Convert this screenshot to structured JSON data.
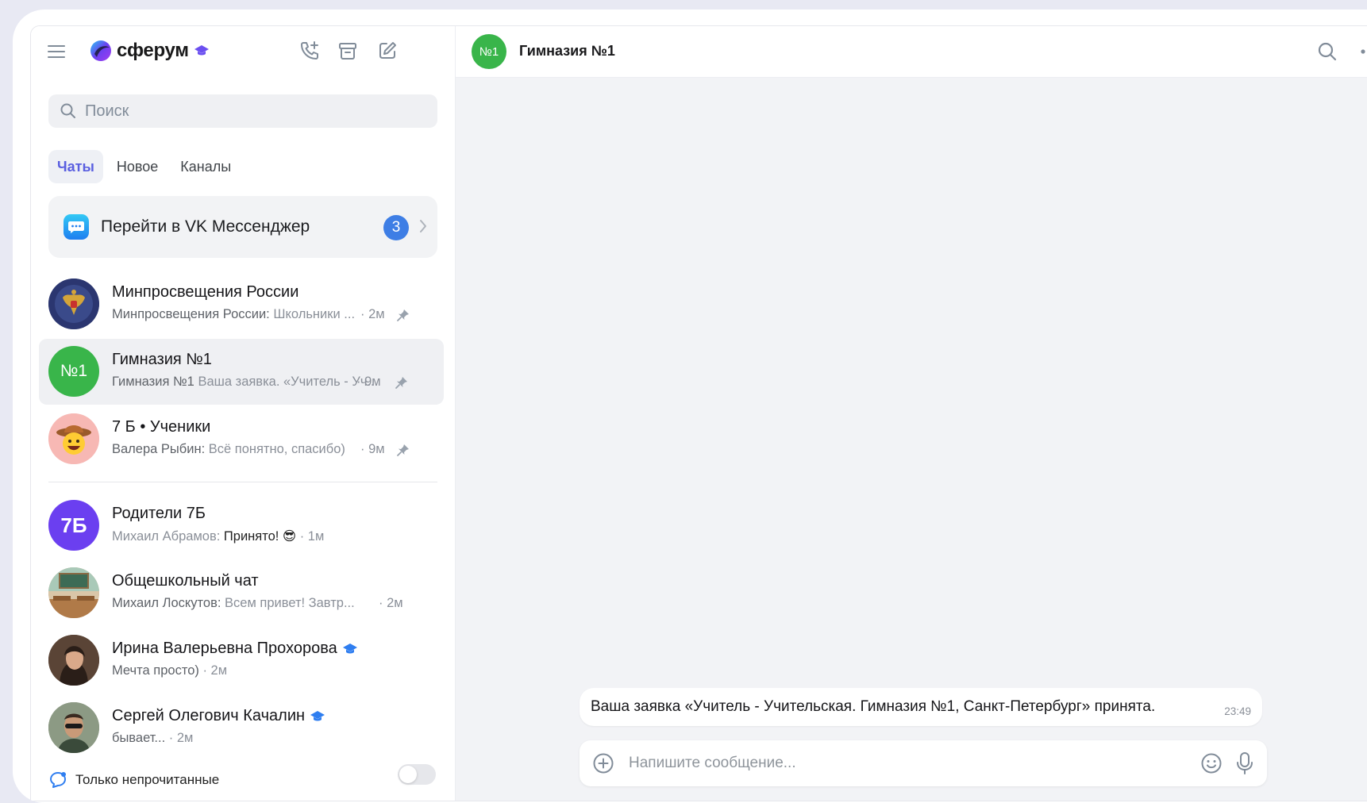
{
  "app": {
    "logo_text": "сферум"
  },
  "search": {
    "placeholder": "Поиск"
  },
  "tabs": [
    {
      "label": "Чаты",
      "active": true
    },
    {
      "label": "Новое",
      "active": false
    },
    {
      "label": "Каналы",
      "active": false
    }
  ],
  "vk_card": {
    "label": "Перейти в VK Мессенджер",
    "badge": "3"
  },
  "chats": [
    {
      "title": "Минпросвещения России",
      "who": "Минпросвещения России:",
      "preview": "Школьники ...",
      "time": "· 2м",
      "pinned": true
    },
    {
      "title": "Гимназия №1",
      "avatar_text": "№1",
      "who": "Гимназия №1",
      "preview": "Ваша заявка. «Учитель - Уч...",
      "time": "· 9м",
      "pinned": true,
      "selected": true
    },
    {
      "title": "7 Б • Ученики",
      "who": "Валера Рыбин:",
      "preview": "Всё понятно, спасибо)",
      "time": "· 9м",
      "pinned": true
    },
    {
      "title": "Родители 7Б",
      "avatar_text": "7Б",
      "who": "Михаил Абрамов:",
      "preview": "Принято! 😎",
      "time": "· 1м",
      "pinned": false
    },
    {
      "title": "Общешкольный чат",
      "who": "Михаил Лоскутов:",
      "preview": "Всем привет! Завтр...",
      "time": "· 2м",
      "pinned": false
    },
    {
      "title": "Ирина Валерьевна Прохорова",
      "who": "",
      "preview": "Мечта просто)",
      "time": "· 2м",
      "pinned": false,
      "verified": true
    },
    {
      "title": "Сергей Олегович Качалин",
      "who": "",
      "preview": "бывает...",
      "time": "· 2м",
      "pinned": false,
      "verified": true
    }
  ],
  "unread_toggle": {
    "label": "Только непрочитанные",
    "on": false
  },
  "conversation": {
    "title": "Гимназия №1",
    "avatar_text": "№1",
    "message": {
      "text": "Ваша заявка «Учитель - Учительская. Гимназия №1, Санкт-Петербург» принята.",
      "time": "23:49"
    },
    "composer_placeholder": "Напишите сообщение..."
  },
  "colors": {
    "accent": "#5a5fe0",
    "badge": "#3e7ee5",
    "green_avatar": "#39b54a",
    "purple_avatar": "#6b3ff0"
  }
}
